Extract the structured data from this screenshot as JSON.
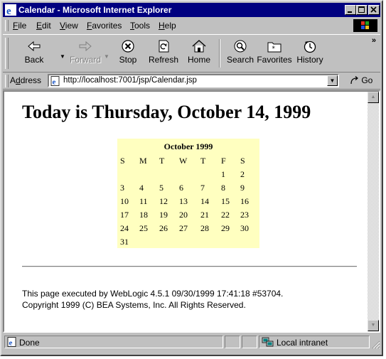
{
  "window": {
    "title": "Calendar - Microsoft Internet Explorer"
  },
  "menu": [
    {
      "label": "File",
      "u": "F",
      "rest": "ile"
    },
    {
      "label": "Edit",
      "u": "E",
      "rest": "dit"
    },
    {
      "label": "View",
      "u": "V",
      "rest": "iew"
    },
    {
      "label": "Favorites",
      "u": "F",
      "rest": "avorites",
      "prefix": "",
      "uidx": 1
    },
    {
      "label": "Tools",
      "u": "T",
      "rest": "ools"
    },
    {
      "label": "Help",
      "u": "H",
      "rest": "elp"
    }
  ],
  "toolbar": {
    "back": "Back",
    "forward": "Forward",
    "stop": "Stop",
    "refresh": "Refresh",
    "home": "Home",
    "search": "Search",
    "favorites": "Favorites",
    "history": "History",
    "more": "»"
  },
  "address": {
    "label_pre": "A",
    "label_u": "d",
    "label_post": "dress",
    "url": "http://localhost:7001/jsp/Calendar.jsp",
    "go": "Go"
  },
  "page": {
    "heading": "Today is Thursday, October 14, 1999",
    "calendar": {
      "title": "October 1999",
      "weekdays": [
        "S",
        "M",
        "T",
        "W",
        "T",
        "F",
        "S"
      ],
      "weeks": [
        [
          "",
          "",
          "",
          "",
          "",
          "1",
          "2"
        ],
        [
          "3",
          "4",
          "5",
          "6",
          "7",
          "8",
          "9"
        ],
        [
          "10",
          "11",
          "12",
          "13",
          "14",
          "15",
          "16"
        ],
        [
          "17",
          "18",
          "19",
          "20",
          "21",
          "22",
          "23"
        ],
        [
          "24",
          "25",
          "26",
          "27",
          "28",
          "29",
          "30"
        ],
        [
          "31",
          "",
          "",
          "",
          "",
          "",
          ""
        ]
      ]
    },
    "footer_line1": "This page executed by WebLogic 4.5.1 09/30/1999 17:41:18 #53704.",
    "footer_line2": "Copyright 1999 (C) BEA Systems, Inc. All Rights Reserved."
  },
  "status": {
    "text": "Done",
    "zone": "Local intranet"
  },
  "colors": {
    "titlebar": "#000080",
    "calendar_bg": "#ffffc0",
    "chrome": "#c0c0c0"
  }
}
